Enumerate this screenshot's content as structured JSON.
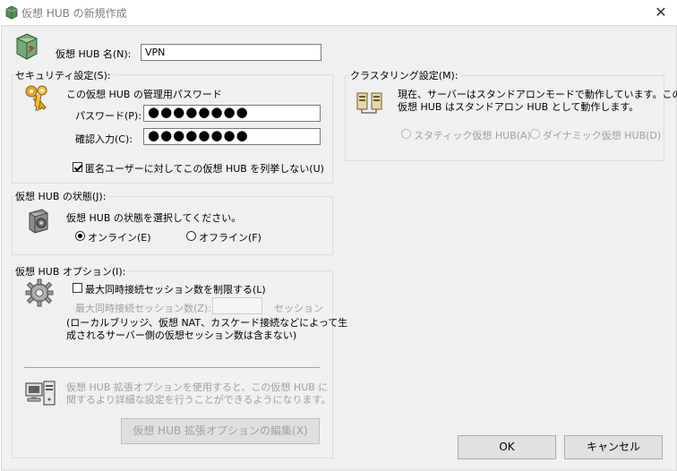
{
  "window": {
    "title": "仮想 HUB の新規作成",
    "close_glyph": "✕"
  },
  "hub_name": {
    "label": "仮想 HUB 名(N):",
    "value": "VPN"
  },
  "security": {
    "group_title": "セキュリティ設定(S):",
    "password_heading": "この仮想 HUB の管理用パスワード",
    "password_label": "パスワード(P):",
    "password_value": "●●●●●●●●",
    "confirm_label": "確認入力(C):",
    "confirm_value": "●●●●●●●●",
    "anonymous_label": "匿名ユーザーに対してこの仮想 HUB を列挙しない(U)",
    "anonymous_checked": true
  },
  "status": {
    "group_title": "仮想 HUB の状態(J):",
    "instruction": "仮想 HUB の状態を選択してください。",
    "online_label": "オンライン(E)",
    "offline_label": "オフライン(F)",
    "selected": "online"
  },
  "options": {
    "group_title": "仮想 HUB オプション(I):",
    "limit_label": "最大同時接続セッション数を制限する(L)",
    "limit_checked": false,
    "max_sessions_label": "最大同時接続セッション数(Z):",
    "max_sessions_value": "",
    "sessions_unit": "セッション",
    "note_line1": "(ローカルブリッジ、仮想 NAT、カスケード接続などによって生",
    "note_line2": "成されるサーバー側の仮想セッション数は含まない)",
    "extended_line1": "仮想 HUB 拡張オプションを使用すると、この仮想 HUB に",
    "extended_line2": "関するより詳細な設定を行うことができるようになります。",
    "extended_button": "仮想 HUB 拡張オプションの編集(X)"
  },
  "clustering": {
    "group_title": "クラスタリング設定(M):",
    "description_line1": "現在、サーバーはスタンドアロンモードで動作しています。この",
    "description_line2": "仮想 HUB はスタンドアロン HUB として動作します。",
    "static_label": "スタティック仮想 HUB(A)",
    "dynamic_label": "ダイナミック仮想 HUB(D)"
  },
  "buttons": {
    "ok": "OK",
    "cancel": "キャンセル"
  },
  "icons": {
    "app": "virtual-hub-icon",
    "hub": "virtual-hub-icon",
    "keys": "keys-icon",
    "status": "safe-icon",
    "options": "gear-icon",
    "extended": "computers-icon",
    "cluster": "servers-icon"
  }
}
